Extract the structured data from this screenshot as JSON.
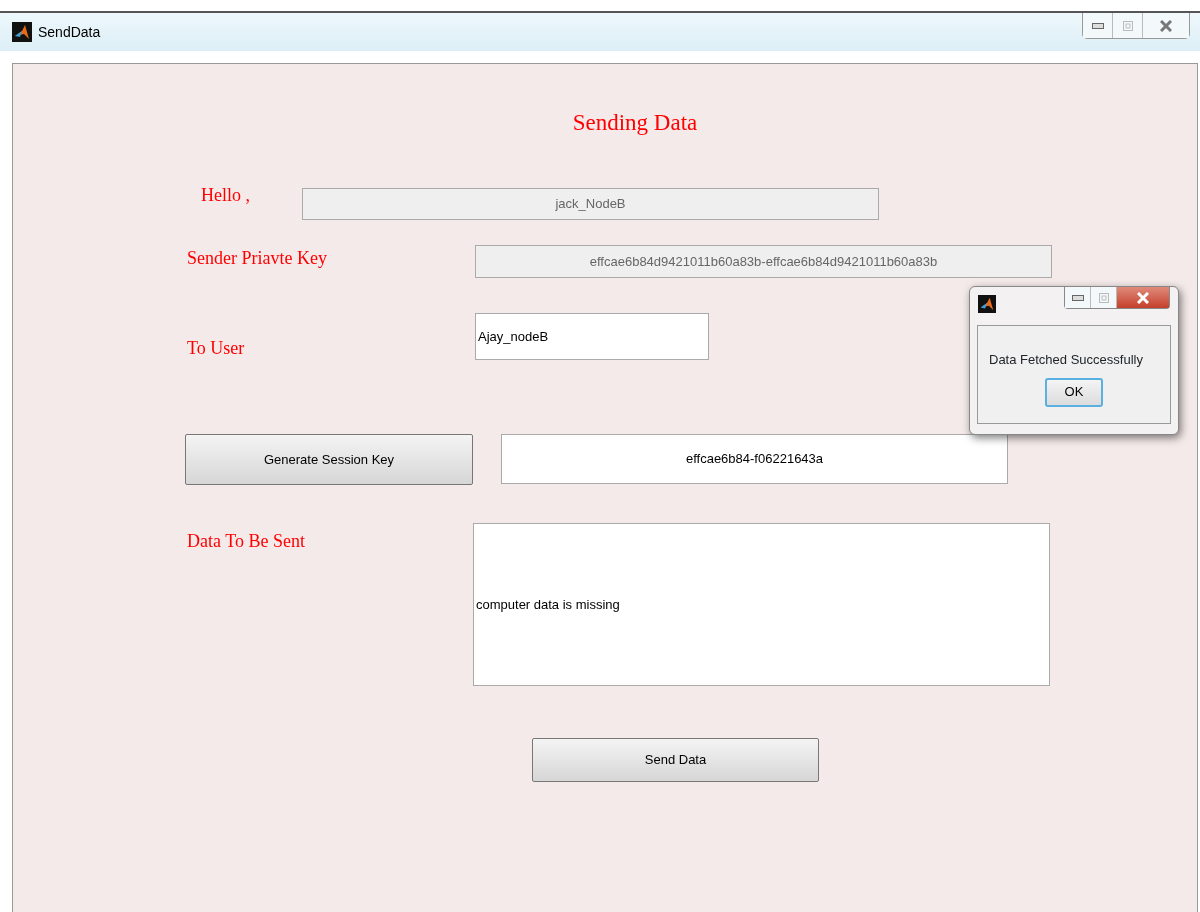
{
  "window": {
    "title": "SendData"
  },
  "heading": "Sending Data",
  "rows": [
    {
      "kind": "field",
      "label": "Hello ,",
      "value": "jack_NodeB",
      "disabled": true
    },
    {
      "kind": "field",
      "label": "Sender Priavte Key",
      "value": "effcae6b84d9421011b60a83b-effcae6b84d9421011b60a83b",
      "disabled": true
    },
    {
      "kind": "field",
      "label": "To User",
      "value": "Ajay_nodeB",
      "disabled": false
    },
    {
      "kind": "action",
      "button": "Generate Session Key",
      "value": "effcae6b84-f06221643a"
    },
    {
      "kind": "textarea",
      "label": "Data To Be Sent",
      "value": "computer data is missing"
    },
    {
      "kind": "submit",
      "button": "Send Data"
    }
  ],
  "dialog": {
    "message": "Data Fetched Successfully",
    "button": "OK"
  }
}
